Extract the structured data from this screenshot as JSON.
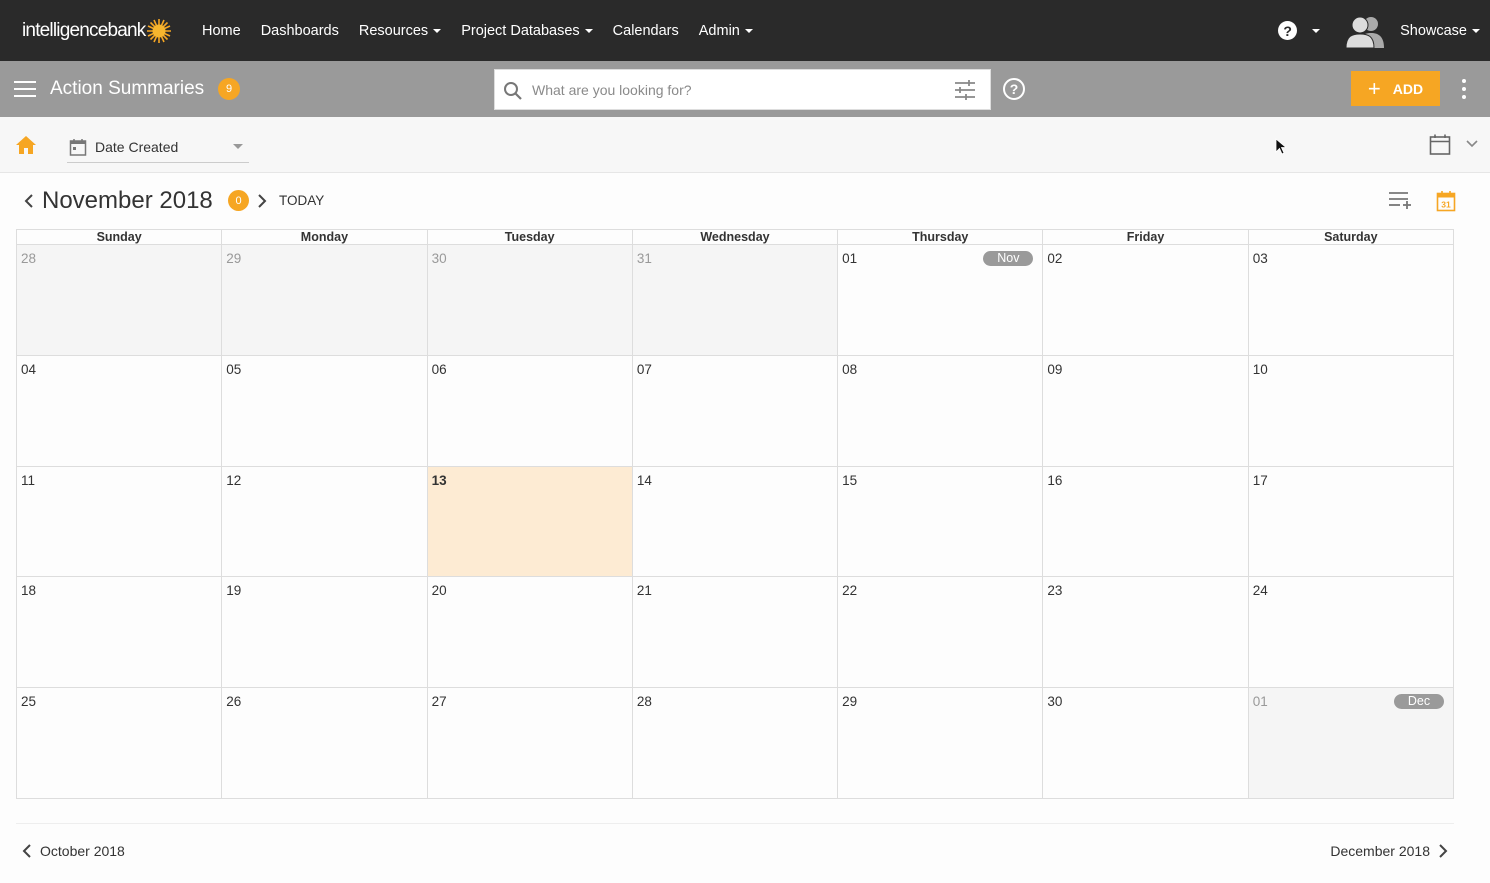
{
  "brand": {
    "logo_text": "intelligencebank",
    "accent": "#f6a623"
  },
  "nav": {
    "items": [
      {
        "label": "Home",
        "dropdown": false
      },
      {
        "label": "Dashboards",
        "dropdown": false
      },
      {
        "label": "Resources",
        "dropdown": true
      },
      {
        "label": "Project Databases",
        "dropdown": true
      },
      {
        "label": "Calendars",
        "dropdown": false
      },
      {
        "label": "Admin",
        "dropdown": true
      }
    ],
    "help_label": "?",
    "user_name": "Showcase"
  },
  "subheader": {
    "title": "Action Summaries",
    "count": "9",
    "search_placeholder": "What are you looking for?",
    "search_help": "?",
    "add_label": "ADD"
  },
  "toolbar": {
    "date_field_label": "Date Created"
  },
  "calendar": {
    "month_title": "November 2018",
    "month_count": "0",
    "today_label": "TODAY",
    "weekdays": [
      "Sunday",
      "Monday",
      "Tuesday",
      "Wednesday",
      "Thursday",
      "Friday",
      "Saturday"
    ],
    "weeks": [
      [
        {
          "num": "28",
          "other": true
        },
        {
          "num": "29",
          "other": true
        },
        {
          "num": "30",
          "other": true
        },
        {
          "num": "31",
          "other": true
        },
        {
          "num": "01",
          "pill": "Nov"
        },
        {
          "num": "02"
        },
        {
          "num": "03"
        }
      ],
      [
        {
          "num": "04"
        },
        {
          "num": "05"
        },
        {
          "num": "06"
        },
        {
          "num": "07"
        },
        {
          "num": "08"
        },
        {
          "num": "09"
        },
        {
          "num": "10"
        }
      ],
      [
        {
          "num": "11"
        },
        {
          "num": "12"
        },
        {
          "num": "13",
          "today": true
        },
        {
          "num": "14"
        },
        {
          "num": "15"
        },
        {
          "num": "16"
        },
        {
          "num": "17"
        }
      ],
      [
        {
          "num": "18"
        },
        {
          "num": "19"
        },
        {
          "num": "20"
        },
        {
          "num": "21"
        },
        {
          "num": "22"
        },
        {
          "num": "23"
        },
        {
          "num": "24"
        }
      ],
      [
        {
          "num": "25"
        },
        {
          "num": "26"
        },
        {
          "num": "27"
        },
        {
          "num": "28"
        },
        {
          "num": "29"
        },
        {
          "num": "30"
        },
        {
          "num": "01",
          "other": true,
          "pill": "Dec"
        }
      ]
    ]
  },
  "footer": {
    "prev_month": "October 2018",
    "next_month": "December 2018"
  }
}
